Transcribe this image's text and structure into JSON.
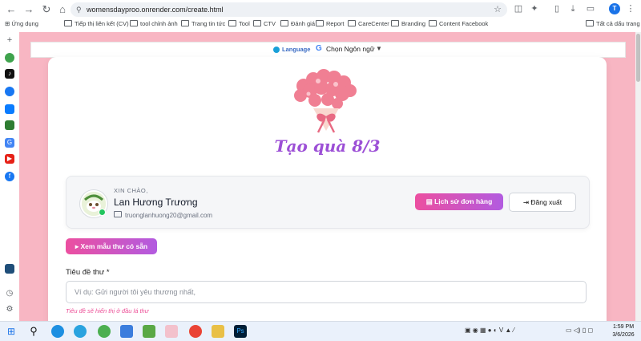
{
  "browser": {
    "url": "womensdayproo.onrender.com/create.html",
    "profile_initial": "T",
    "bookmarks": [
      "Ứng dụng",
      "Tiếp thị liên kết (CV)",
      "tool chỉnh ảnh",
      "Trang tin tức",
      "Tool",
      "CTV",
      "Đánh giá",
      "Report",
      "CareCenter",
      "Branding",
      "Content Facebook"
    ],
    "all_bookmarks": "Tất cả dấu trang"
  },
  "language_bar": {
    "label": "Language",
    "select": "Chọn Ngôn ngữ",
    "arrow": "▼"
  },
  "main": {
    "title": "Tạo quà 8/3",
    "user": {
      "greeting": "XIN CHÀO,",
      "name": "Lan Hương Trương",
      "email": "truonglanhuong20@gmail.com"
    },
    "history_button": "Lịch sử đơn hàng",
    "logout_button": "Đăng xuất",
    "sample_button": "Xem mẫu thư có sẵn",
    "subject_label": "Tiêu đề thư *",
    "subject_placeholder": "Ví dụ: Gửi người tôi yêu thương nhất,",
    "subject_hint": "Tiêu đề sẽ hiển thị ở đầu lá thư"
  },
  "taskbar": {
    "time": "1:59 PM",
    "date": "3/6/2026"
  },
  "colors": {
    "page_bg": "#f8b6c3",
    "accent_pink": "#ec4fa0",
    "accent_purple": "#b25be0",
    "title": "#9c4fd6"
  }
}
